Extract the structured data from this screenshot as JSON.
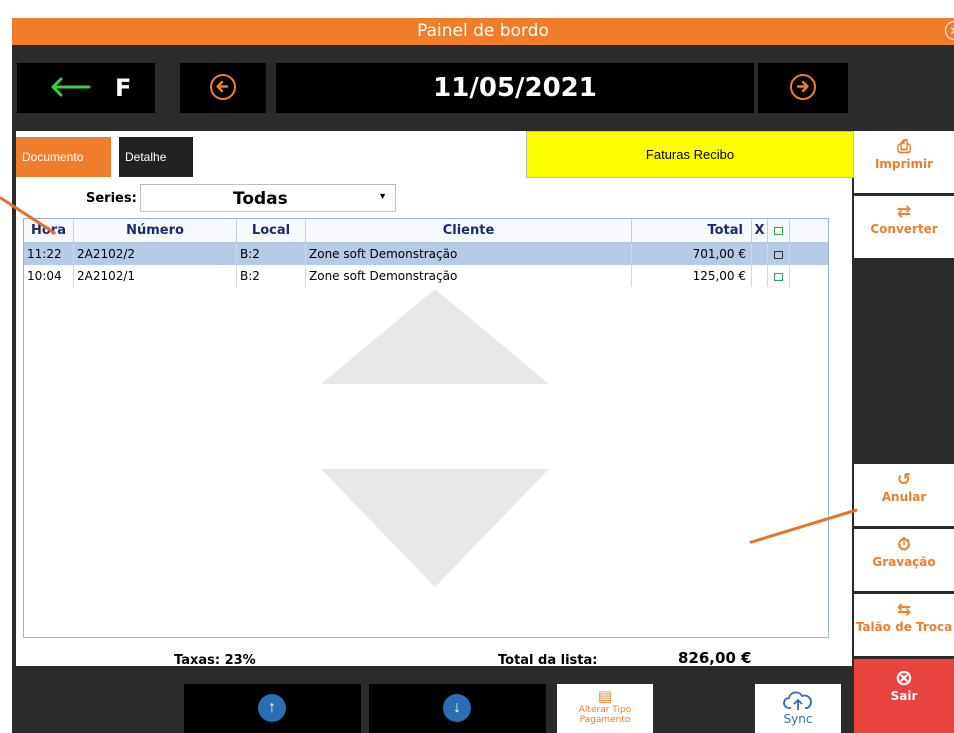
{
  "window": {
    "title": "Painel de bordo",
    "close_icon": "close-icon"
  },
  "nav": {
    "back_letter": "F",
    "date": "11/05/2021"
  },
  "tabs": [
    {
      "label": "Documento"
    },
    {
      "label": "Detalhe"
    }
  ],
  "doc_type": "Faturas Recibo",
  "series": {
    "label": "Series:",
    "value": "Todas"
  },
  "table": {
    "headers": {
      "hora": "Hora",
      "numero": "Número",
      "local": "Local",
      "cliente": "Cliente",
      "total": "Total",
      "x": "X"
    },
    "rows": [
      {
        "hora": "11:22",
        "numero": "2A2102/2",
        "local": "B:2",
        "cliente": "Zone soft Demonstração",
        "total": "701,00 €",
        "selected": true
      },
      {
        "hora": "10:04",
        "numero": "2A2102/1",
        "local": "B:2",
        "cliente": "Zone soft Demonstração",
        "total": "125,00 €",
        "selected": false
      }
    ]
  },
  "footer": {
    "taxas": "Taxas: 23%",
    "total_label": "Total da lista:",
    "total_value": "826,00 €"
  },
  "side_buttons": {
    "imprimir": "Imprimir",
    "converter": "Converter",
    "anular": "Anular",
    "gravacao": "Gravação",
    "talao": "Talão de Troca",
    "sair": "Sair"
  },
  "bottom": {
    "alterar_line1": "Alterar Tipo",
    "alterar_line2": "Pagamento",
    "sync": "Sync"
  },
  "colors": {
    "accent": "#f07d2c",
    "exit": "#e8433f",
    "highlight": "#ffff00",
    "selected_row": "#b8cbe6"
  }
}
